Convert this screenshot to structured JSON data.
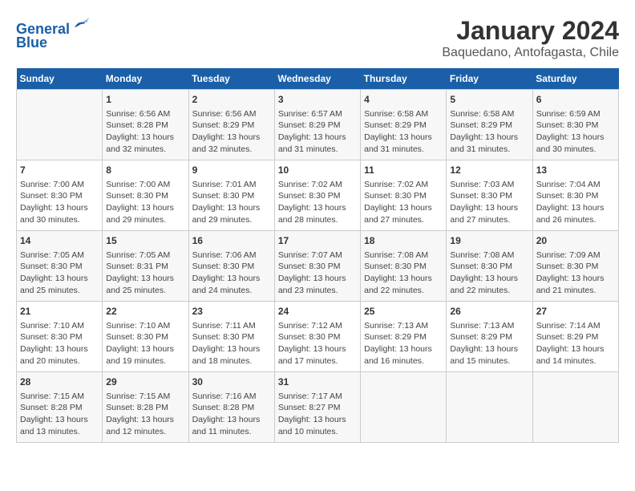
{
  "logo": {
    "line1": "General",
    "line2": "Blue"
  },
  "title": "January 2024",
  "subtitle": "Baquedano, Antofagasta, Chile",
  "headers": [
    "Sunday",
    "Monday",
    "Tuesday",
    "Wednesday",
    "Thursday",
    "Friday",
    "Saturday"
  ],
  "weeks": [
    [
      {
        "day": "",
        "info": ""
      },
      {
        "day": "1",
        "info": "Sunrise: 6:56 AM\nSunset: 8:28 PM\nDaylight: 13 hours\nand 32 minutes."
      },
      {
        "day": "2",
        "info": "Sunrise: 6:56 AM\nSunset: 8:29 PM\nDaylight: 13 hours\nand 32 minutes."
      },
      {
        "day": "3",
        "info": "Sunrise: 6:57 AM\nSunset: 8:29 PM\nDaylight: 13 hours\nand 31 minutes."
      },
      {
        "day": "4",
        "info": "Sunrise: 6:58 AM\nSunset: 8:29 PM\nDaylight: 13 hours\nand 31 minutes."
      },
      {
        "day": "5",
        "info": "Sunrise: 6:58 AM\nSunset: 8:29 PM\nDaylight: 13 hours\nand 31 minutes."
      },
      {
        "day": "6",
        "info": "Sunrise: 6:59 AM\nSunset: 8:30 PM\nDaylight: 13 hours\nand 30 minutes."
      }
    ],
    [
      {
        "day": "7",
        "info": "Sunrise: 7:00 AM\nSunset: 8:30 PM\nDaylight: 13 hours\nand 30 minutes."
      },
      {
        "day": "8",
        "info": "Sunrise: 7:00 AM\nSunset: 8:30 PM\nDaylight: 13 hours\nand 29 minutes."
      },
      {
        "day": "9",
        "info": "Sunrise: 7:01 AM\nSunset: 8:30 PM\nDaylight: 13 hours\nand 29 minutes."
      },
      {
        "day": "10",
        "info": "Sunrise: 7:02 AM\nSunset: 8:30 PM\nDaylight: 13 hours\nand 28 minutes."
      },
      {
        "day": "11",
        "info": "Sunrise: 7:02 AM\nSunset: 8:30 PM\nDaylight: 13 hours\nand 27 minutes."
      },
      {
        "day": "12",
        "info": "Sunrise: 7:03 AM\nSunset: 8:30 PM\nDaylight: 13 hours\nand 27 minutes."
      },
      {
        "day": "13",
        "info": "Sunrise: 7:04 AM\nSunset: 8:30 PM\nDaylight: 13 hours\nand 26 minutes."
      }
    ],
    [
      {
        "day": "14",
        "info": "Sunrise: 7:05 AM\nSunset: 8:30 PM\nDaylight: 13 hours\nand 25 minutes."
      },
      {
        "day": "15",
        "info": "Sunrise: 7:05 AM\nSunset: 8:31 PM\nDaylight: 13 hours\nand 25 minutes."
      },
      {
        "day": "16",
        "info": "Sunrise: 7:06 AM\nSunset: 8:30 PM\nDaylight: 13 hours\nand 24 minutes."
      },
      {
        "day": "17",
        "info": "Sunrise: 7:07 AM\nSunset: 8:30 PM\nDaylight: 13 hours\nand 23 minutes."
      },
      {
        "day": "18",
        "info": "Sunrise: 7:08 AM\nSunset: 8:30 PM\nDaylight: 13 hours\nand 22 minutes."
      },
      {
        "day": "19",
        "info": "Sunrise: 7:08 AM\nSunset: 8:30 PM\nDaylight: 13 hours\nand 22 minutes."
      },
      {
        "day": "20",
        "info": "Sunrise: 7:09 AM\nSunset: 8:30 PM\nDaylight: 13 hours\nand 21 minutes."
      }
    ],
    [
      {
        "day": "21",
        "info": "Sunrise: 7:10 AM\nSunset: 8:30 PM\nDaylight: 13 hours\nand 20 minutes."
      },
      {
        "day": "22",
        "info": "Sunrise: 7:10 AM\nSunset: 8:30 PM\nDaylight: 13 hours\nand 19 minutes."
      },
      {
        "day": "23",
        "info": "Sunrise: 7:11 AM\nSunset: 8:30 PM\nDaylight: 13 hours\nand 18 minutes."
      },
      {
        "day": "24",
        "info": "Sunrise: 7:12 AM\nSunset: 8:30 PM\nDaylight: 13 hours\nand 17 minutes."
      },
      {
        "day": "25",
        "info": "Sunrise: 7:13 AM\nSunset: 8:29 PM\nDaylight: 13 hours\nand 16 minutes."
      },
      {
        "day": "26",
        "info": "Sunrise: 7:13 AM\nSunset: 8:29 PM\nDaylight: 13 hours\nand 15 minutes."
      },
      {
        "day": "27",
        "info": "Sunrise: 7:14 AM\nSunset: 8:29 PM\nDaylight: 13 hours\nand 14 minutes."
      }
    ],
    [
      {
        "day": "28",
        "info": "Sunrise: 7:15 AM\nSunset: 8:28 PM\nDaylight: 13 hours\nand 13 minutes."
      },
      {
        "day": "29",
        "info": "Sunrise: 7:15 AM\nSunset: 8:28 PM\nDaylight: 13 hours\nand 12 minutes."
      },
      {
        "day": "30",
        "info": "Sunrise: 7:16 AM\nSunset: 8:28 PM\nDaylight: 13 hours\nand 11 minutes."
      },
      {
        "day": "31",
        "info": "Sunrise: 7:17 AM\nSunset: 8:27 PM\nDaylight: 13 hours\nand 10 minutes."
      },
      {
        "day": "",
        "info": ""
      },
      {
        "day": "",
        "info": ""
      },
      {
        "day": "",
        "info": ""
      }
    ]
  ]
}
